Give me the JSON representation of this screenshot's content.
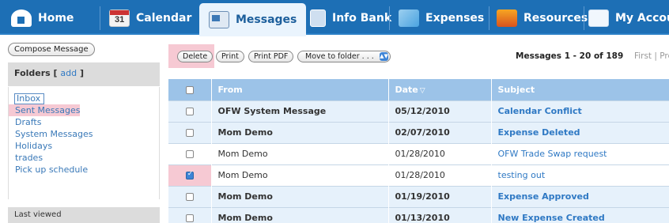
{
  "nav": {
    "tabs": [
      {
        "label": "Home",
        "icon": "home-icon"
      },
      {
        "label": "Calendar",
        "icon": "calendar-icon",
        "icon_text": "31"
      },
      {
        "label": "Messages",
        "icon": "messages-icon",
        "active": true
      },
      {
        "label": "Info Bank",
        "icon": "info-bank-icon"
      },
      {
        "label": "Expenses",
        "icon": "expenses-icon"
      },
      {
        "label": "Resources",
        "icon": "resources-icon"
      },
      {
        "label": "My Accou",
        "icon": "account-icon"
      }
    ]
  },
  "sidebar": {
    "compose_label": "Compose Message",
    "folders_title": "Folders",
    "add_label": "add",
    "folders": [
      "Inbox",
      "Sent Messages",
      "Drafts",
      "System Messages",
      "Holidays",
      "trades",
      "Pick up schedule"
    ],
    "last_viewed": "Last viewed"
  },
  "toolbar": {
    "delete_label": "Delete",
    "print_label": "Print",
    "print_pdf_label": "Print PDF",
    "move_label": "Move to folder . . .",
    "pager_text": "Messages 1 - 20 of 189",
    "pager_links": "First | Pre"
  },
  "table": {
    "headers": {
      "from": "From",
      "date": "Date",
      "subject": "Subject"
    },
    "rows": [
      {
        "from": "OFW System Message",
        "date": "05/12/2010",
        "subject": "Calendar Conflict",
        "unread": true,
        "checked": false
      },
      {
        "from": "Mom Demo",
        "date": "02/07/2010",
        "subject": "Expense Deleted",
        "unread": true,
        "checked": false
      },
      {
        "from": "Mom Demo",
        "date": "01/28/2010",
        "subject": "OFW Trade Swap request",
        "unread": false,
        "checked": false
      },
      {
        "from": "Mom Demo",
        "date": "01/28/2010",
        "subject": "testing out",
        "unread": false,
        "checked": true
      },
      {
        "from": "Mom Demo",
        "date": "01/19/2010",
        "subject": "Expense Approved",
        "unread": true,
        "checked": false
      },
      {
        "from": "Mom Demo",
        "date": "01/13/2010",
        "subject": "New Expense Created",
        "unread": true,
        "checked": false
      }
    ]
  },
  "colors": {
    "nav_bg": "#1d6fb5",
    "header_bg": "#9cc3e8",
    "highlight": "#f6c9d3",
    "link": "#2f79c4"
  }
}
